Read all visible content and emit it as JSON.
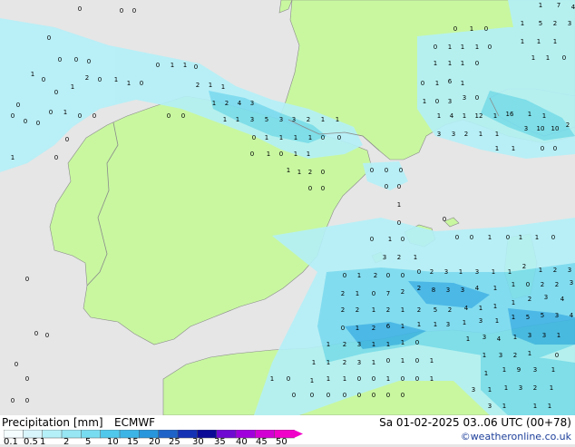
{
  "map": {
    "colors": {
      "sea": "#e6e6e6",
      "land": "#c8f7a0",
      "border": "#8a8a8a",
      "precip_light": "#b4f0f8",
      "precip_mid": "#78dcf0",
      "precip_strong": "#3cb4e6"
    },
    "visible_values": [
      "0",
      "1",
      "2",
      "3",
      "4",
      "5",
      "6",
      "7",
      "8",
      "9",
      "10",
      "12",
      "16"
    ]
  },
  "legend": {
    "title": "Precipitation [mm]",
    "model": "ECMWF",
    "ticks": [
      "0.1",
      "0.5",
      "1",
      "2",
      "5",
      "10",
      "15",
      "20",
      "25",
      "30",
      "35",
      "40",
      "45",
      "50"
    ],
    "colors": [
      "#f5fcfe",
      "#d8f5fc",
      "#b4f0f8",
      "#96e6f4",
      "#78dcf0",
      "#50c8ec",
      "#3cb4e6",
      "#2896dc",
      "#1e64c8",
      "#1432b4",
      "#0a0a96",
      "#6e0ad2",
      "#a000dc",
      "#d200d2",
      "#f000c8"
    ]
  },
  "header": {
    "datetime": "Sa 01-02-2025 03..06 UTC (00+78)",
    "credit": "©weatheronline.co.uk"
  }
}
